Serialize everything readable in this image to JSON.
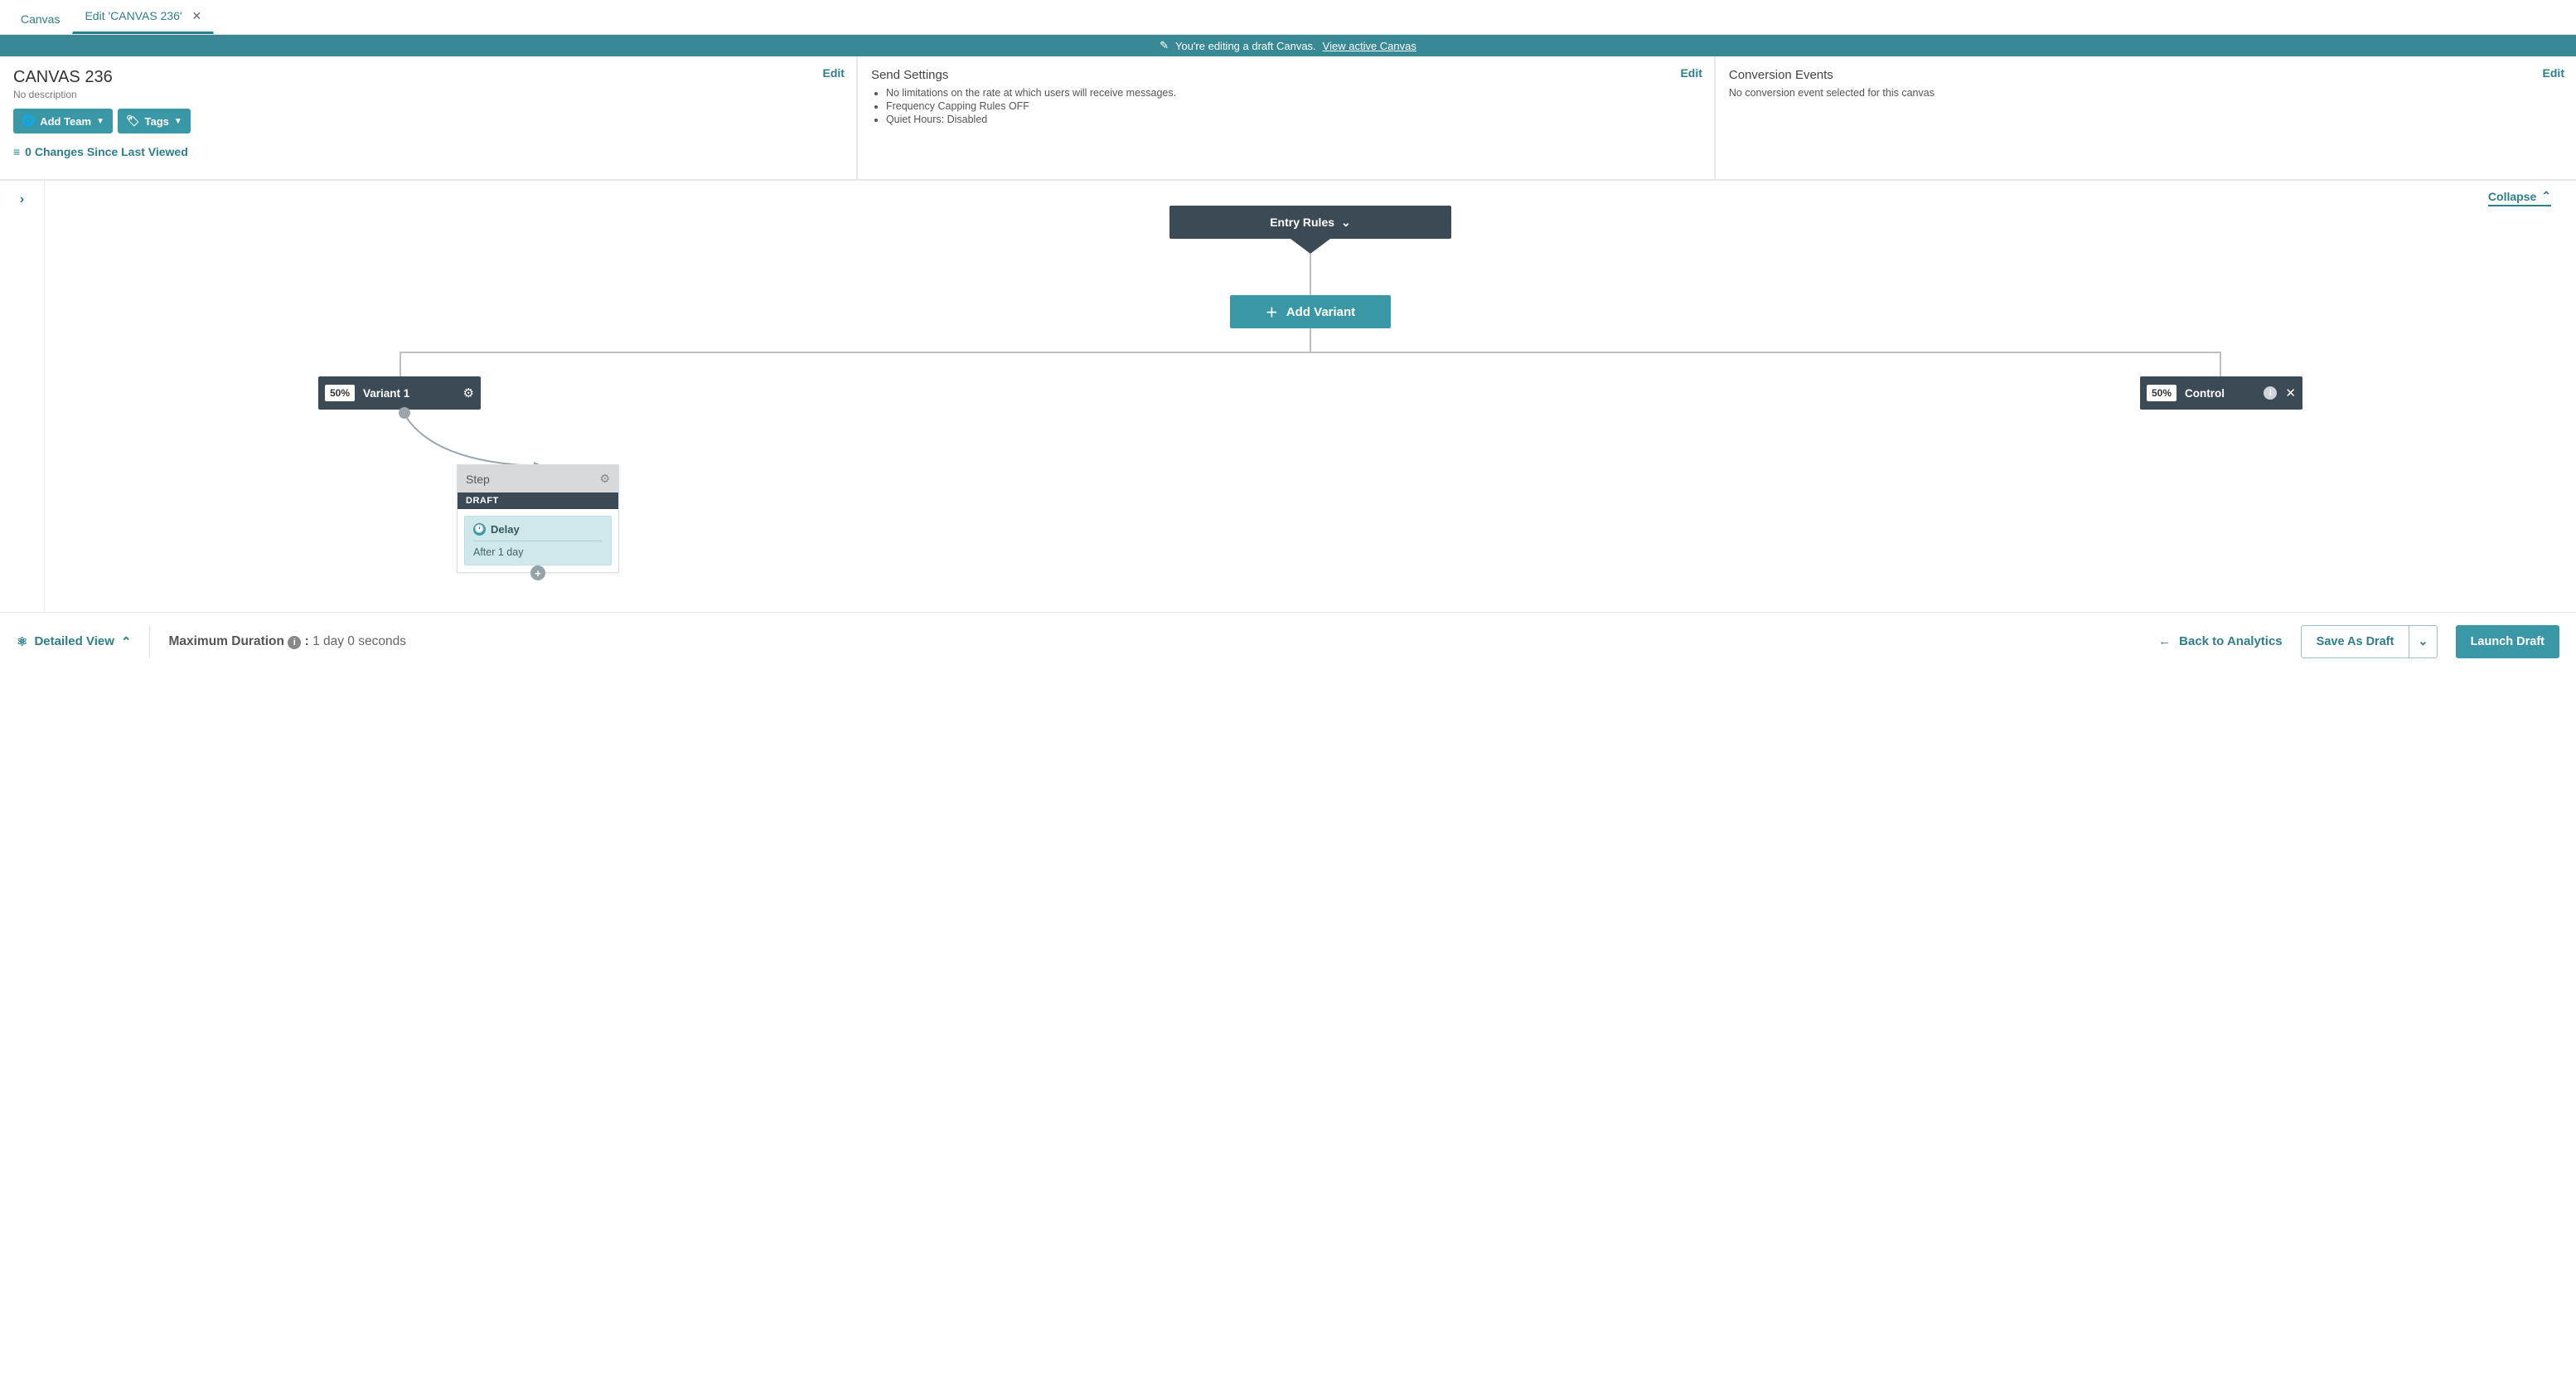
{
  "tabs": {
    "canvas": "Canvas",
    "edit": "Edit 'CANVAS 236'"
  },
  "banner": {
    "text": "You're editing a draft Canvas.",
    "link": "View active Canvas"
  },
  "panel1": {
    "title": "CANVAS 236",
    "desc": "No description",
    "add_team": "Add Team",
    "tags": "Tags",
    "changes": "0 Changes Since Last Viewed",
    "edit": "Edit"
  },
  "panel2": {
    "title": "Send Settings",
    "b1": "No limitations on the rate at which users will receive messages.",
    "b2": "Frequency Capping Rules OFF",
    "b3": "Quiet Hours: Disabled",
    "edit": "Edit"
  },
  "panel3": {
    "title": "Conversion Events",
    "text": "No conversion event selected for this canvas",
    "edit": "Edit"
  },
  "workspace": {
    "collapse": "Collapse",
    "entry_rules": "Entry Rules",
    "add_variant": "Add Variant",
    "variant1": {
      "pct": "50%",
      "name": "Variant 1"
    },
    "control": {
      "pct": "50%",
      "name": "Control"
    },
    "step": {
      "title": "Step",
      "badge": "DRAFT",
      "delay_label": "Delay",
      "delay_value": "After 1 day"
    }
  },
  "footer": {
    "detailed": "Detailed View",
    "max_label": "Maximum Duration",
    "max_value": "1 day 0 seconds",
    "back": "Back to Analytics",
    "save": "Save As Draft",
    "launch": "Launch Draft"
  }
}
